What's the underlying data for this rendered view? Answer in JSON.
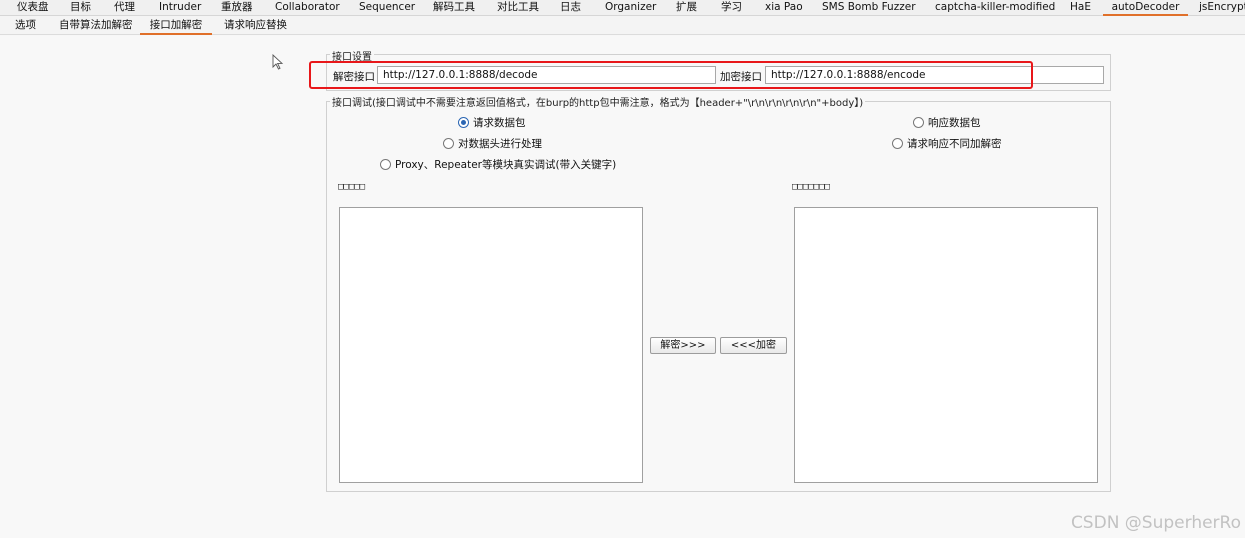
{
  "top_tabs": [
    {
      "label": "仪表盘"
    },
    {
      "label": "目标"
    },
    {
      "label": "代理"
    },
    {
      "label": "Intruder"
    },
    {
      "label": "重放器"
    },
    {
      "label": "Collaborator"
    },
    {
      "label": "Sequencer"
    },
    {
      "label": "解码工具"
    },
    {
      "label": "对比工具"
    },
    {
      "label": "日志"
    },
    {
      "label": "Organizer"
    },
    {
      "label": "扩展"
    },
    {
      "label": "学习"
    },
    {
      "label": "xia Pao"
    },
    {
      "label": "SMS Bomb Fuzzer"
    },
    {
      "label": "captcha-killer-modified"
    },
    {
      "label": "HaE"
    },
    {
      "label": "autoDecoder",
      "active": true
    },
    {
      "label": "jsEncrypter"
    }
  ],
  "sub_tabs": [
    {
      "label": "选项"
    },
    {
      "label": "自带算法加解密"
    },
    {
      "label": "接口加解密",
      "active": true
    },
    {
      "label": "请求响应替换"
    }
  ],
  "interface_settings": {
    "legend": "接口设置",
    "decode_label": "解密接口",
    "decode_value": "http://127.0.0.1:8888/decode",
    "encode_label": "加密接口",
    "encode_value": "http://127.0.0.1:8888/encode",
    "extra_value": ""
  },
  "debug": {
    "legend": "接口调试(接口调试中不需要注意返回值格式，在burp的http包中需注意，格式为【header+\"\\r\\n\\r\\n\\r\\n\\r\\n\"+body】)",
    "radio_request": "请求数据包",
    "radio_response": "响应数据包",
    "radio_header": "对数据头进行处理",
    "radio_diff": "请求响应不同加解密",
    "radio_proxy": "Proxy、Repeater等模块真实调试(带入关键字)",
    "left_label": "□□□□□",
    "right_label": "□□□□□□□",
    "decrypt_button": "解密>>>",
    "encrypt_button": "<<<加密",
    "left_text": "",
    "right_text": ""
  },
  "watermark": "CSDN @SuperherRo",
  "colors": {
    "active_tab_underline": "#e0702a",
    "highlight_box": "#e8171a",
    "radio_selected": "#2b66b3"
  }
}
